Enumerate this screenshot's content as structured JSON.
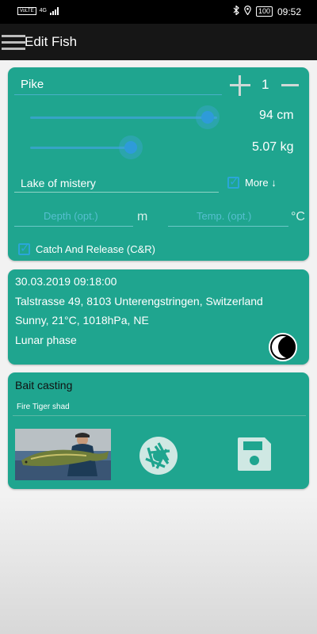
{
  "status_bar": {
    "network_badge": "VoLTE",
    "network_type": "4G",
    "battery": "100",
    "time": "09:52"
  },
  "app_bar": {
    "title": "Edit Fish"
  },
  "catch": {
    "species": "Pike",
    "count": "1",
    "length_text": "94 cm",
    "length_fraction": 0.98,
    "weight_text": "5.07 kg",
    "weight_fraction": 0.54,
    "location_name": "Lake of mistery",
    "more_label": "More ↓",
    "depth_placeholder": "Depth (opt.)",
    "depth_unit": "m",
    "temp_placeholder": "Temp. (opt.)",
    "temp_unit": "°C",
    "catch_release_label": "Catch And Release (C&R)",
    "catch_release_checked": true,
    "more_checked": true
  },
  "details": {
    "datetime": "30.03.2019 09:18:00",
    "address": "Talstrasse 49, 8103 Unterengstringen, Switzerland",
    "weather": "Sunny, 21°C, 1018hPa, NE",
    "lunar_label": "Lunar phase"
  },
  "method": {
    "technique": "Bait casting",
    "bait": "Fire Tiger shad"
  },
  "colors": {
    "card": "#1fa58f",
    "accent": "#2e9bd9",
    "appbar": "#161616"
  },
  "icons": [
    "menu-icon",
    "plus-icon",
    "minus-icon",
    "moon-phase-icon",
    "camera-shutter-icon",
    "save-icon",
    "check-icon"
  ]
}
